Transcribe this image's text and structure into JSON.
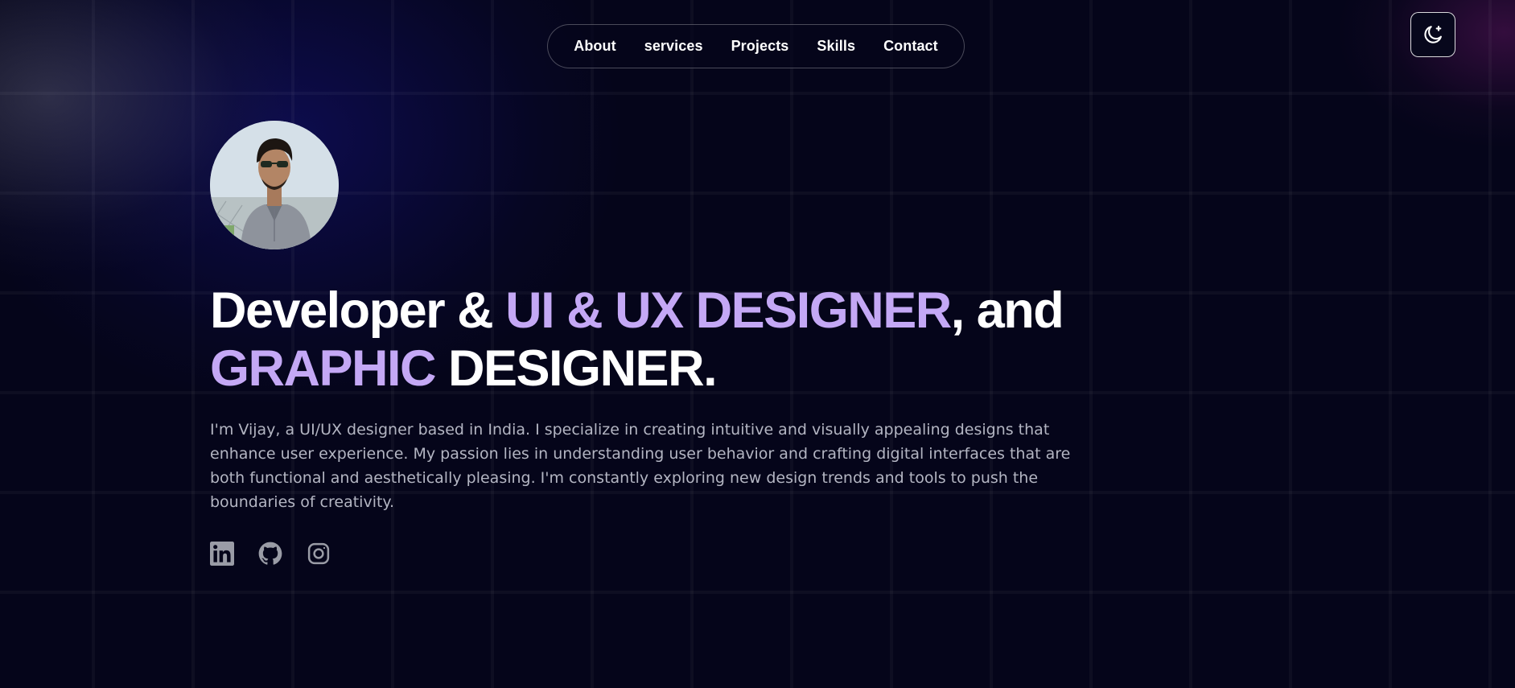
{
  "nav": {
    "items": [
      {
        "label": "About"
      },
      {
        "label": "services"
      },
      {
        "label": "Projects"
      },
      {
        "label": "Skills"
      },
      {
        "label": "Contact"
      }
    ]
  },
  "theme_toggle": {
    "icon": "moon-icon"
  },
  "hero": {
    "avatar_icon": "profile-photo",
    "headline": {
      "part1": "Developer & ",
      "accent1": "UI & UX DESIGNER",
      "part2": ", and",
      "accent2": "GRAPHIC",
      "part3": " DESIGNER."
    },
    "bio": "I'm Vijay, a UI/UX designer based in India. I specialize in creating intuitive and visually appealing designs that enhance user experience. My passion lies in understanding user behavior and crafting digital interfaces that are both functional and aesthetically pleasing. I'm constantly exploring new design trends and tools to push the boundaries of creativity."
  },
  "socials": [
    {
      "icon": "linkedin-icon"
    },
    {
      "icon": "github-icon"
    },
    {
      "icon": "instagram-icon"
    }
  ],
  "colors": {
    "background": "#05051a",
    "accent": "#c4a8f5",
    "text": "#ffffff",
    "muted_text": "#b3b5c2",
    "icon_gray": "#9a9ca6"
  }
}
